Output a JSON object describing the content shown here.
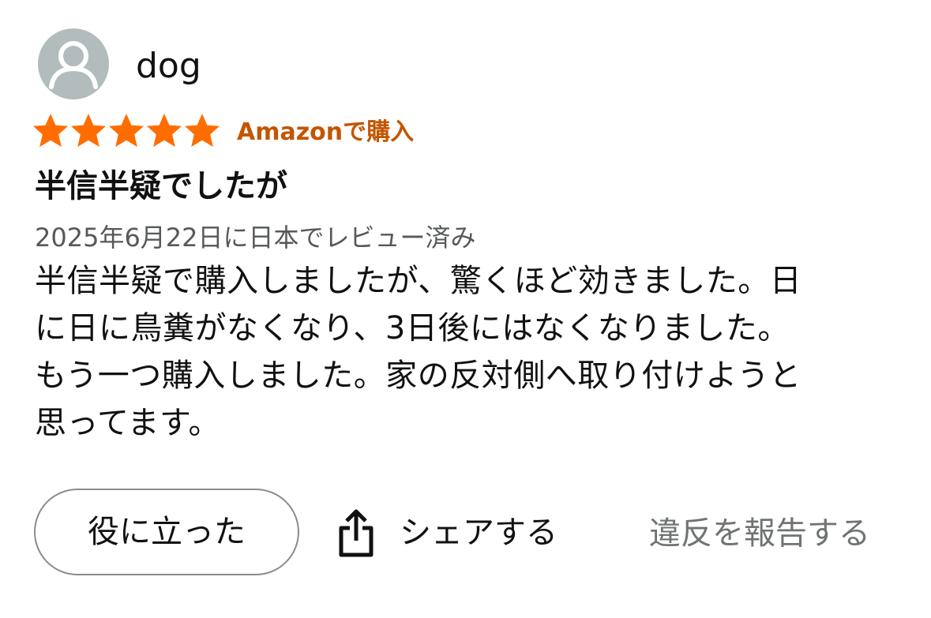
{
  "reviewer": {
    "name": "dog",
    "avatar_icon": "person-silhouette-icon"
  },
  "rating": {
    "stars": 5,
    "max_stars": 5,
    "star_color": "#ff6d00",
    "badge_label": "Amazonで購入",
    "badge_color": "#c45500"
  },
  "review": {
    "title": "半信半疑でしたが",
    "date_line": "2025年6月22日に日本でレビュー済み",
    "body_lines": [
      "半信半疑で購入しましたが、驚くほど効きました。日",
      "に日に鳥糞がなくなり、3日後にはなくなりました。",
      "もう一つ購入しました。家の反対側へ取り付けようと",
      "思ってます。"
    ]
  },
  "actions": {
    "helpful_label": "役に立った",
    "share_label": "シェアする",
    "share_icon": "share-upload-icon",
    "report_label": "違反を報告する"
  }
}
